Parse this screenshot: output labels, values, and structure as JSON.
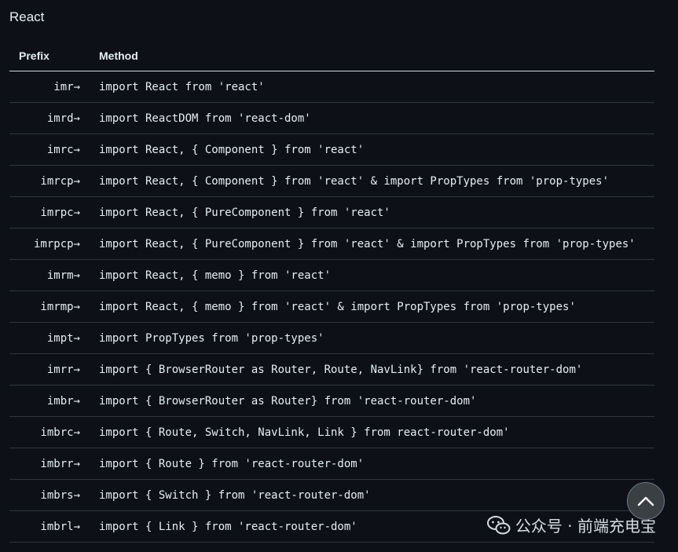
{
  "section_title": "React",
  "table": {
    "headers": {
      "prefix": "Prefix",
      "method": "Method"
    },
    "rows": [
      {
        "prefix": "imr→",
        "method": "import React from 'react'"
      },
      {
        "prefix": "imrd→",
        "method": "import ReactDOM from 'react-dom'"
      },
      {
        "prefix": "imrc→",
        "method": "import React, { Component } from 'react'"
      },
      {
        "prefix": "imrcp→",
        "method": "import React, { Component } from 'react' & import PropTypes from 'prop-types'"
      },
      {
        "prefix": "imrpc→",
        "method": "import React, { PureComponent } from 'react'"
      },
      {
        "prefix": "imrpcp→",
        "method": "import React, { PureComponent } from 'react' & import PropTypes from 'prop-types'"
      },
      {
        "prefix": "imrm→",
        "method": "import React, { memo } from 'react'"
      },
      {
        "prefix": "imrmp→",
        "method": "import React, { memo } from 'react' & import PropTypes from 'prop-types'"
      },
      {
        "prefix": "impt→",
        "method": "import PropTypes from 'prop-types'"
      },
      {
        "prefix": "imrr→",
        "method": "import { BrowserRouter as Router, Route, NavLink} from 'react-router-dom'"
      },
      {
        "prefix": "imbr→",
        "method": "import { BrowserRouter as Router} from 'react-router-dom'"
      },
      {
        "prefix": "imbrc→",
        "method": "import { Route, Switch, NavLink, Link } from react-router-dom'"
      },
      {
        "prefix": "imbrr→",
        "method": "import { Route } from 'react-router-dom'"
      },
      {
        "prefix": "imbrs→",
        "method": "import { Switch } from 'react-router-dom'"
      },
      {
        "prefix": "imbrl→",
        "method": "import { Link } from 'react-router-dom'"
      }
    ]
  },
  "watermark": {
    "text": "公众号 · 前端充电宝",
    "icon": "wechat-icon"
  },
  "scroll_top": {
    "icon": "chevron-up-icon"
  }
}
